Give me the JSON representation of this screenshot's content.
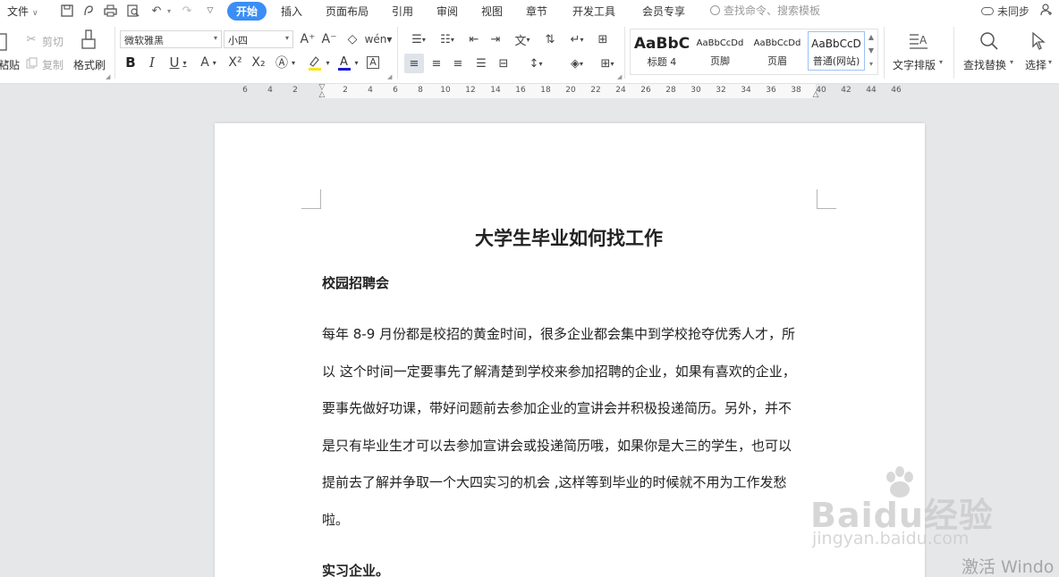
{
  "menu": {
    "file_label": "文件",
    "tabs": [
      "开始",
      "插入",
      "页面布局",
      "引用",
      "审阅",
      "视图",
      "章节",
      "开发工具",
      "会员专享"
    ],
    "search_placeholder": "查找命令、搜索模板",
    "sync_label": "未同步"
  },
  "ribbon": {
    "paste_label": "粘贴",
    "cut_label": "剪切",
    "copy_label": "复制",
    "format_painter_label": "格式刷",
    "font_name": "微软雅黑",
    "font_size": "小四",
    "styles": [
      {
        "preview": "AaBbC",
        "label": "标题 4"
      },
      {
        "preview": "AaBbCcDd",
        "label": "页脚"
      },
      {
        "preview": "AaBbCcDd",
        "label": "页眉"
      },
      {
        "preview": "AaBbCcD",
        "label": "普通(网站)"
      }
    ],
    "text_layout_label": "文字排版",
    "find_replace_label": "查找替换",
    "select_label": "选择"
  },
  "ruler": {
    "ticks": [
      "6",
      "4",
      "2",
      "2",
      "4",
      "6",
      "8",
      "10",
      "12",
      "14",
      "16",
      "18",
      "20",
      "22",
      "24",
      "26",
      "28",
      "30",
      "32",
      "34",
      "36",
      "38",
      "40",
      "42",
      "44",
      "46"
    ]
  },
  "document": {
    "title": "大学生毕业如何找工作",
    "heading1": "校园招聘会",
    "paragraph1_lines": [
      "每年 8-9 月份都是校招的黄金时间，很多企业都会集中到学校抢夺优秀人才，所",
      "以 这个时间一定要事先了解清楚到学校来参加招聘的企业，如果有喜欢的企业，",
      "要事先做好功课，带好问题前去参加企业的宣讲会并积极投递简历。另外，并不",
      "是只有毕业生才可以去参加宣讲会或投递简历哦，如果你是大三的学生，也可以",
      "提前去了解并争取一个大四实习的机会 ,这样等到毕业的时候就不用为工作发愁",
      "啦。"
    ],
    "heading2": "实习企业。"
  },
  "watermarks": {
    "baidu_brand": "Baidu经验",
    "baidu_url": "jingyan.baidu.com",
    "activate": "激活 Windo"
  }
}
